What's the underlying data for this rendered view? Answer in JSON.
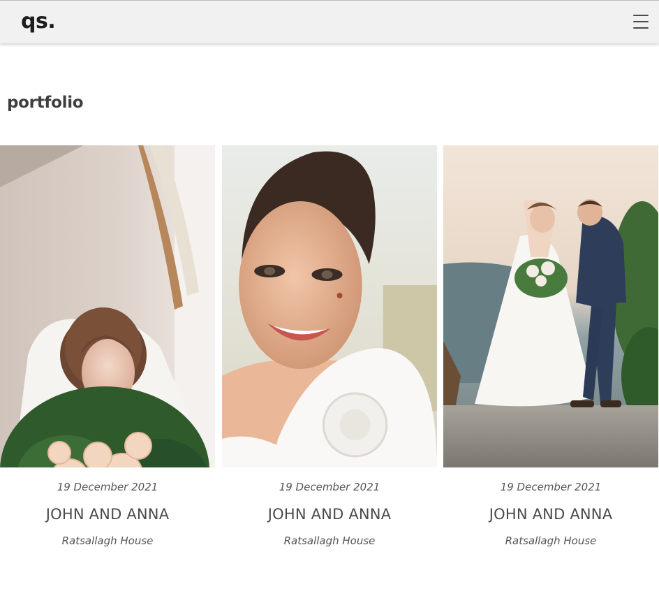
{
  "header": {
    "logo": "qs.",
    "menu_icon": "hamburger-menu-icon"
  },
  "page": {
    "title": "portfolio"
  },
  "portfolio": {
    "items": [
      {
        "date": "19 December 2021",
        "couple": "JOHN AND ANNA",
        "venue": "Ratsallagh House",
        "photo": "bride-with-bouquet"
      },
      {
        "date": "19 December 2021",
        "couple": "JOHN AND ANNA",
        "venue": "Ratsallagh House",
        "photo": "smiling-bride-closeup"
      },
      {
        "date": "19 December 2021",
        "couple": "JOHN AND ANNA",
        "venue": "Ratsallagh House",
        "photo": "couple-outdoors"
      }
    ]
  },
  "colors": {
    "header_bg": "#f1f1f1",
    "text_dark": "#3e3e3e",
    "text_meta": "#555555"
  }
}
